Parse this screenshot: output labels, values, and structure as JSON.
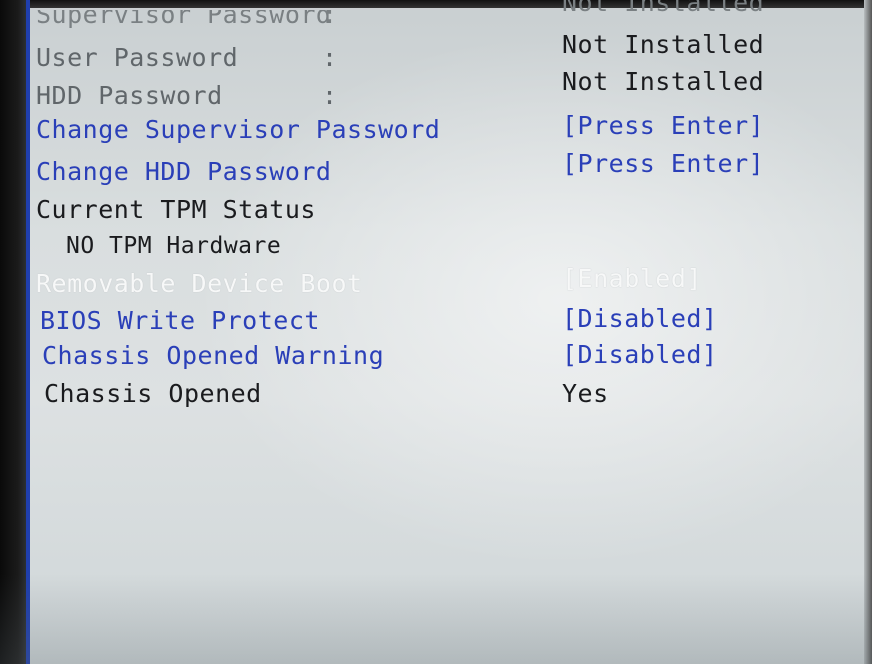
{
  "security_items": [
    {
      "label": "Supervisor Password",
      "sep": ":",
      "value": "Not Installed"
    },
    {
      "label": "User Password",
      "sep": ":",
      "value": "Not Installed"
    },
    {
      "label": "HDD Password",
      "sep": ":",
      "value": "Not Installed"
    },
    {
      "label": "Change Supervisor Password",
      "value": "[Press Enter]"
    },
    {
      "label": "Change HDD Password",
      "value": "[Press Enter]"
    }
  ],
  "tpm": {
    "heading": "Current TPM Status",
    "status": "NO TPM Hardware"
  },
  "boot_items": [
    {
      "label": "Removable Device Boot",
      "value": "[Enabled]"
    },
    {
      "label": "BIOS Write Protect",
      "value": "[Disabled]"
    },
    {
      "label": "Chassis Opened Warning",
      "value": "[Disabled]"
    },
    {
      "label": "Chassis Opened",
      "value": "Yes"
    }
  ],
  "colors": {
    "highlight": "#f7f8f8",
    "selectable": "#2a3fb8",
    "readonly": "#1a1b1e",
    "dim": "#60666a"
  }
}
